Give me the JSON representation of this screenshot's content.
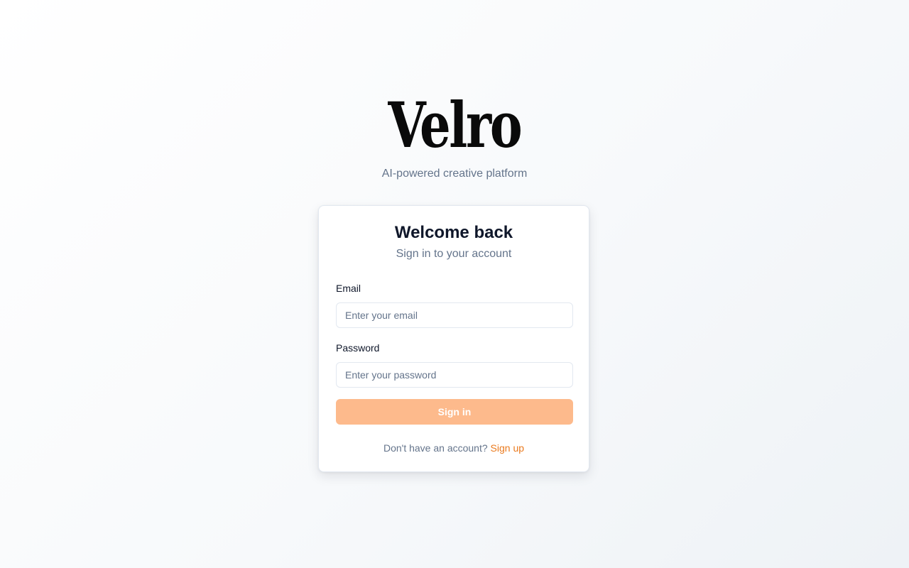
{
  "brand": {
    "logo_text": "Velro",
    "tagline": "AI-powered creative platform"
  },
  "login_card": {
    "title": "Welcome back",
    "subtitle": "Sign in to your account",
    "email": {
      "label": "Email",
      "value": "",
      "placeholder": "Enter your email"
    },
    "password": {
      "label": "Password",
      "value": "",
      "placeholder": "Enter your password"
    },
    "submit_label": "Sign in",
    "footer_text": "Don't have an account?",
    "signup_link_label": "Sign up"
  },
  "colors": {
    "accent": "#ea7a1e",
    "button_disabled": "#fdba8c",
    "muted_text": "#64748b",
    "border": "#e2e8f0"
  }
}
